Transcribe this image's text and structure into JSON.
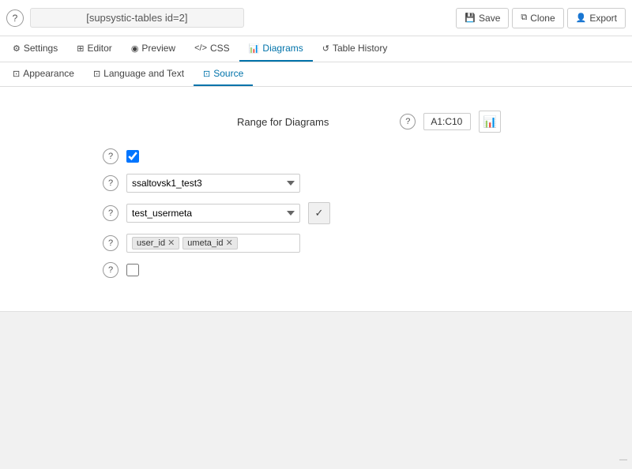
{
  "topbar": {
    "help_label": "?",
    "title": "[supsystic-tables id=2]",
    "save_label": "Save",
    "clone_label": "Clone",
    "export_label": "Export",
    "save_icon": "💾",
    "clone_icon": "⧉",
    "export_icon": "👤"
  },
  "main_tabs": [
    {
      "id": "settings",
      "label": "Settings",
      "icon": "⚙"
    },
    {
      "id": "editor",
      "label": "Editor",
      "icon": "⊞"
    },
    {
      "id": "preview",
      "label": "Preview",
      "icon": "◉"
    },
    {
      "id": "css",
      "label": "CSS",
      "icon": "<>"
    },
    {
      "id": "diagrams",
      "label": "Diagrams",
      "icon": "📊"
    },
    {
      "id": "table-history",
      "label": "Table History",
      "icon": "↺"
    }
  ],
  "sub_tabs": [
    {
      "id": "appearance",
      "label": "Appearance",
      "icon": "⊡"
    },
    {
      "id": "language-text",
      "label": "Language and Text",
      "icon": "⊡"
    },
    {
      "id": "source",
      "label": "Source",
      "icon": "⊡"
    }
  ],
  "diagrams": {
    "range_label": "Range for Diagrams",
    "range_help": "?",
    "range_value": "A1:C10",
    "chart_icon": "📊"
  },
  "form_rows": [
    {
      "id": "row1",
      "help": "?",
      "type": "checkbox",
      "checked": true
    },
    {
      "id": "row2",
      "help": "?",
      "type": "select",
      "value": "ssaltovsk1_test3",
      "options": [
        "ssaltovsk1_test3"
      ]
    },
    {
      "id": "row3",
      "help": "?",
      "type": "select-check",
      "value": "test_usermeta",
      "options": [
        "test_usermeta"
      ],
      "checked": true
    },
    {
      "id": "row4",
      "help": "?",
      "type": "tags",
      "tags": [
        "user_id",
        "umeta_id"
      ]
    },
    {
      "id": "row5",
      "help": "?",
      "type": "checkbox",
      "checked": false
    }
  ]
}
